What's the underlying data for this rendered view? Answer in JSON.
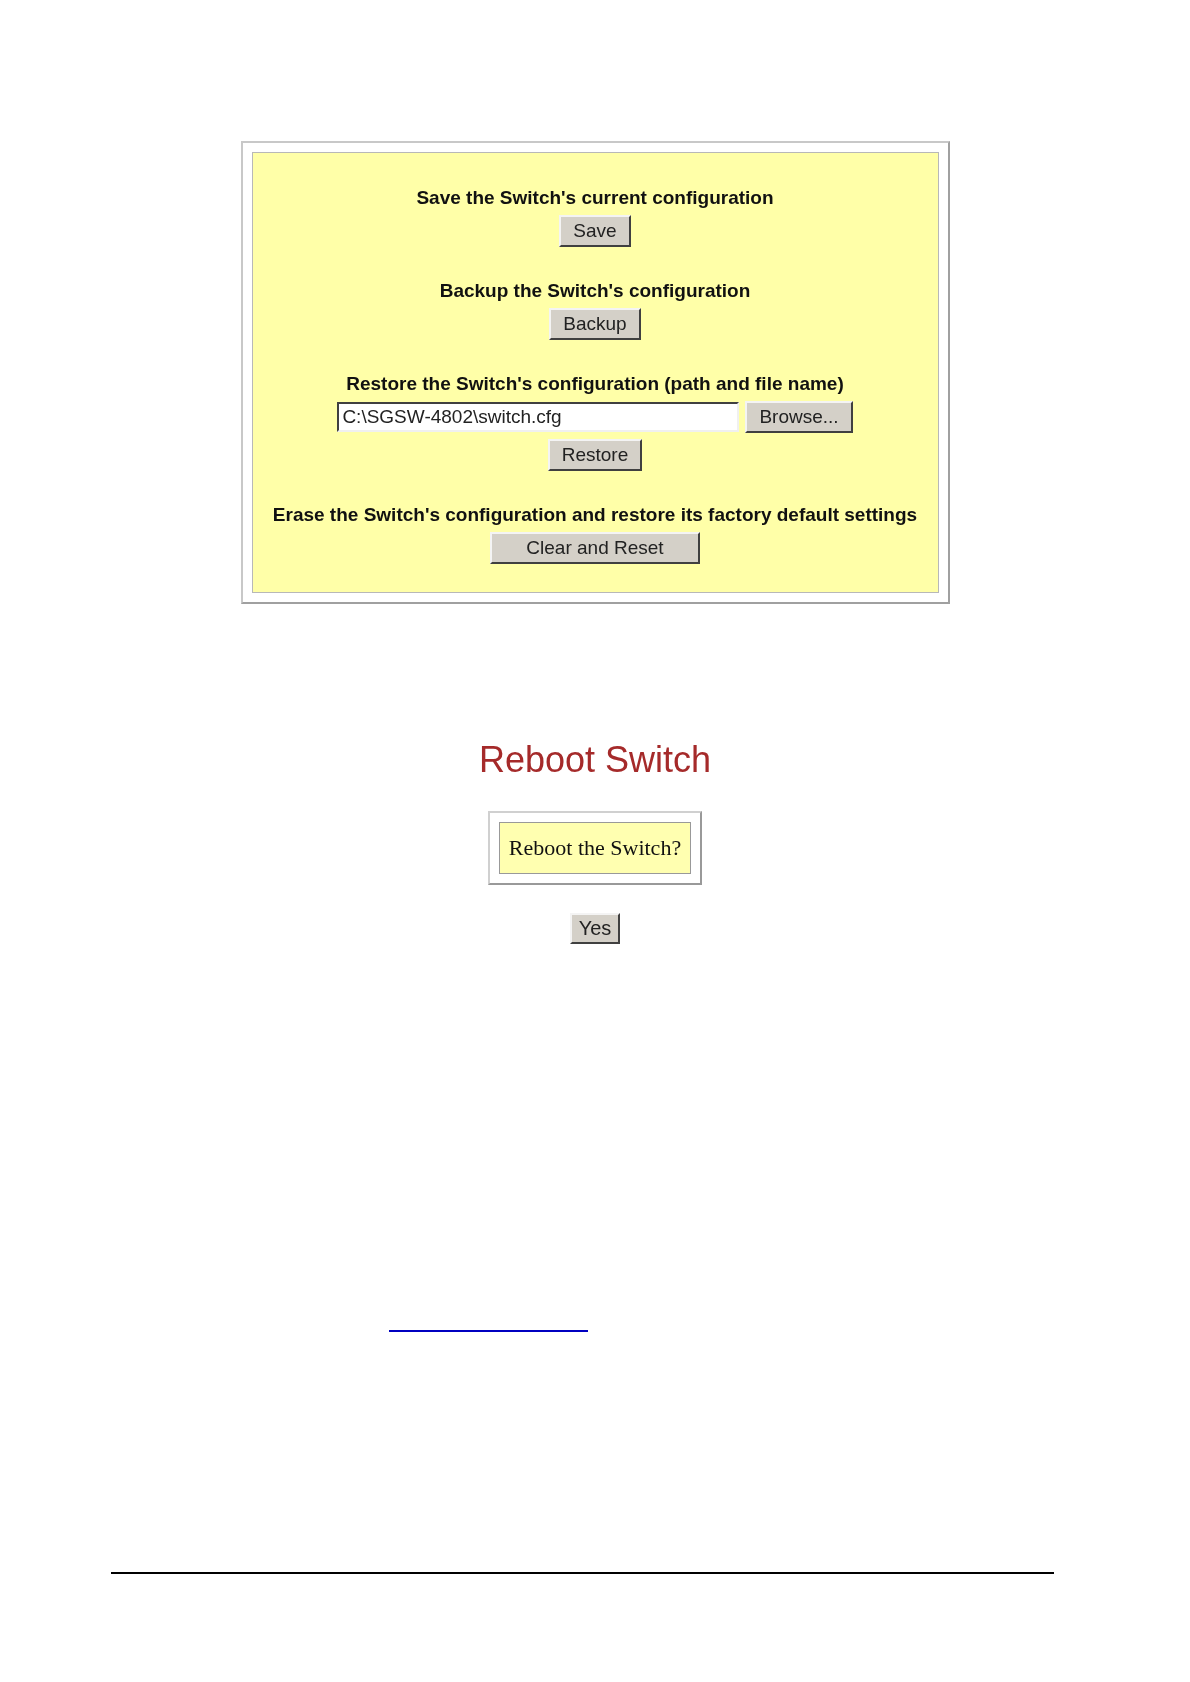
{
  "config_panel": {
    "sections": [
      {
        "kind": "button",
        "label": "Save the Switch's current configuration",
        "button": "Save"
      },
      {
        "kind": "button",
        "label": "Backup the Switch's configuration",
        "button": "Backup"
      },
      {
        "kind": "file",
        "label": "Restore the Switch's configuration (path and file name)",
        "value": "C:\\SGSW-4802\\switch.cfg",
        "browse": "Browse...",
        "button": "Restore"
      },
      {
        "kind": "button",
        "label": "Erase the Switch's configuration and restore its factory default settings",
        "button": "Clear and Reset"
      }
    ]
  },
  "reboot": {
    "title": "Reboot Switch",
    "prompt": "Reboot the Switch?",
    "button": "Yes"
  }
}
